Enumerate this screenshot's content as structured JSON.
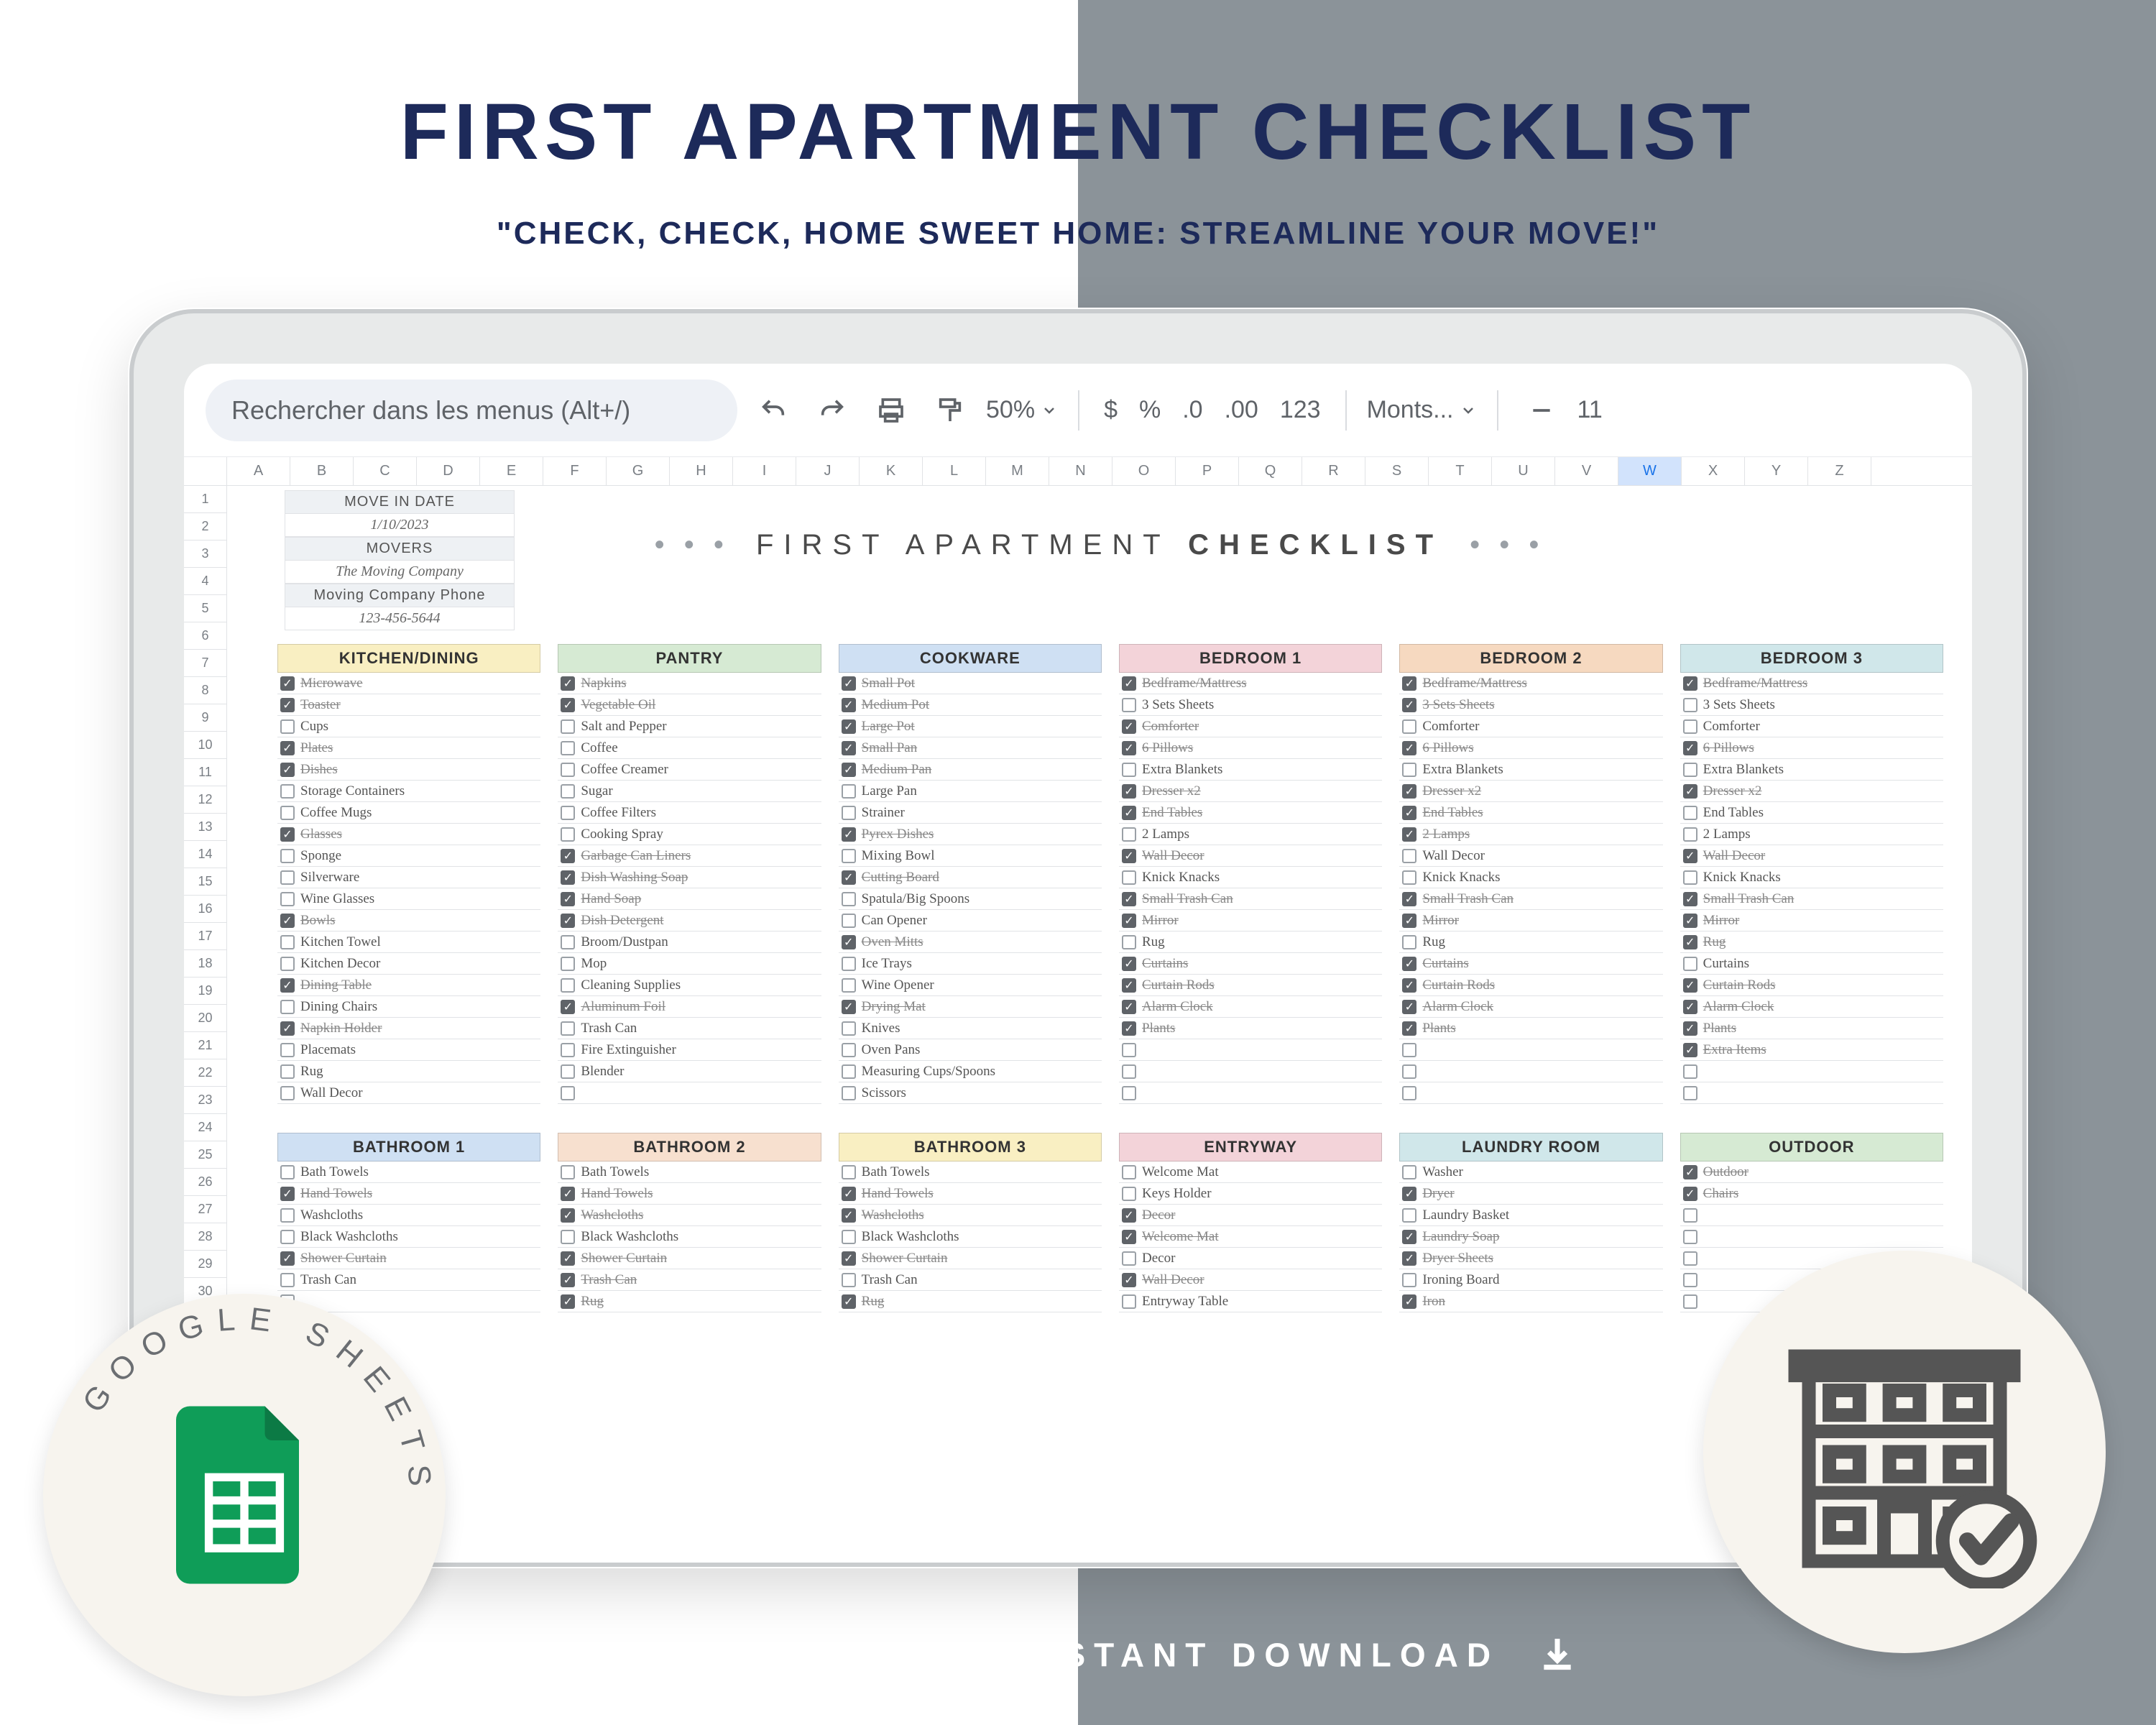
{
  "title": "FIRST APARTMENT CHECKLIST",
  "subtitle": "\"CHECK, CHECK, HOME SWEET HOME: STREAMLINE YOUR MOVE!\"",
  "footer": "GOOGLESHEETS | INSTANT DOWNLOAD",
  "toolbar": {
    "search_placeholder": "Rechercher dans les menus (Alt+/)",
    "zoom": "50%",
    "currency": "$",
    "percent": "%",
    "dec_minus": ".0",
    "dec_plus": ".00",
    "format_123": "123",
    "font": "Monts...",
    "font_size": "11"
  },
  "columns": [
    "A",
    "B",
    "C",
    "D",
    "E",
    "F",
    "G",
    "H",
    "I",
    "J",
    "K",
    "L",
    "M",
    "N",
    "O",
    "P",
    "Q",
    "R",
    "S",
    "T",
    "U",
    "V",
    "W",
    "X",
    "Y",
    "Z"
  ],
  "selected_column_index": 22,
  "row_count": 37,
  "info": {
    "move_in_label": "MOVE IN DATE",
    "move_in_value": "1/10/2023",
    "movers_label": "MOVERS",
    "movers_value": "The Moving Company",
    "phone_label": "Moving Company Phone",
    "phone_value": "123-456-5644"
  },
  "sheet_title_pre": "FIRST APARTMENT ",
  "sheet_title_bold": "CHECKLIST",
  "badge_text": "GOOGLE SHEETS",
  "category_colors": {
    "yellow": "#f9efc2",
    "green": "#d6ead3",
    "blue": "#cfe0f3",
    "pink": "#f3d3d9",
    "orange": "#f6d9c0",
    "lblue": "#d0e7ea",
    "peach": "#f7e0cf"
  },
  "categories_row1": [
    {
      "name": "KITCHEN/DINING",
      "color": "yellow",
      "items": [
        {
          "label": "Microwave",
          "done": true
        },
        {
          "label": "Toaster",
          "done": true
        },
        {
          "label": "Cups",
          "done": false
        },
        {
          "label": "Plates",
          "done": true
        },
        {
          "label": "Dishes",
          "done": true
        },
        {
          "label": "Storage Containers",
          "done": false
        },
        {
          "label": "Coffee Mugs",
          "done": false
        },
        {
          "label": "Glasses",
          "done": true
        },
        {
          "label": "Sponge",
          "done": false
        },
        {
          "label": "Silverware",
          "done": false
        },
        {
          "label": "Wine Glasses",
          "done": false
        },
        {
          "label": "Bowls",
          "done": true
        },
        {
          "label": "Kitchen Towel",
          "done": false
        },
        {
          "label": "Kitchen Decor",
          "done": false
        },
        {
          "label": "Dining Table",
          "done": true
        },
        {
          "label": "Dining Chairs",
          "done": false
        },
        {
          "label": "Napkin Holder",
          "done": true
        },
        {
          "label": "Placemats",
          "done": false
        },
        {
          "label": "Rug",
          "done": false
        },
        {
          "label": "Wall Decor",
          "done": false
        }
      ]
    },
    {
      "name": "PANTRY",
      "color": "green",
      "items": [
        {
          "label": "Napkins",
          "done": true
        },
        {
          "label": "Vegetable Oil",
          "done": true
        },
        {
          "label": "Salt and Pepper",
          "done": false
        },
        {
          "label": "Coffee",
          "done": false
        },
        {
          "label": "Coffee Creamer",
          "done": false
        },
        {
          "label": "Sugar",
          "done": false
        },
        {
          "label": "Coffee Filters",
          "done": false
        },
        {
          "label": "Cooking Spray",
          "done": false
        },
        {
          "label": "Garbage Can Liners",
          "done": true
        },
        {
          "label": "Dish Washing Soap",
          "done": true
        },
        {
          "label": "Hand Soap",
          "done": true
        },
        {
          "label": "Dish Detergent",
          "done": true
        },
        {
          "label": "Broom/Dustpan",
          "done": false
        },
        {
          "label": "Mop",
          "done": false
        },
        {
          "label": "Cleaning Supplies",
          "done": false
        },
        {
          "label": "Aluminum Foil",
          "done": true
        },
        {
          "label": "Trash Can",
          "done": false
        },
        {
          "label": "Fire Extinguisher",
          "done": false
        },
        {
          "label": "Blender",
          "done": false
        },
        {
          "label": "",
          "done": false
        }
      ]
    },
    {
      "name": "COOKWARE",
      "color": "blue",
      "items": [
        {
          "label": "Small Pot",
          "done": true
        },
        {
          "label": "Medium Pot",
          "done": true
        },
        {
          "label": "Large Pot",
          "done": true
        },
        {
          "label": "Small Pan",
          "done": true
        },
        {
          "label": "Medium Pan",
          "done": true
        },
        {
          "label": "Large Pan",
          "done": false
        },
        {
          "label": "Strainer",
          "done": false
        },
        {
          "label": "Pyrex Dishes",
          "done": true
        },
        {
          "label": "Mixing Bowl",
          "done": false
        },
        {
          "label": "Cutting Board",
          "done": true
        },
        {
          "label": "Spatula/Big Spoons",
          "done": false
        },
        {
          "label": "Can Opener",
          "done": false
        },
        {
          "label": "Oven Mitts",
          "done": true
        },
        {
          "label": "Ice Trays",
          "done": false
        },
        {
          "label": "Wine Opener",
          "done": false
        },
        {
          "label": "Drying Mat",
          "done": true
        },
        {
          "label": "Knives",
          "done": false
        },
        {
          "label": "Oven Pans",
          "done": false
        },
        {
          "label": "Measuring Cups/Spoons",
          "done": false
        },
        {
          "label": "Scissors",
          "done": false
        }
      ]
    },
    {
      "name": "BEDROOM 1",
      "color": "pink",
      "items": [
        {
          "label": "Bedframe/Mattress",
          "done": true
        },
        {
          "label": "3 Sets Sheets",
          "done": false
        },
        {
          "label": "Comforter",
          "done": true
        },
        {
          "label": "6 Pillows",
          "done": true
        },
        {
          "label": "Extra Blankets",
          "done": false
        },
        {
          "label": "Dresser x2",
          "done": true
        },
        {
          "label": "End Tables",
          "done": true
        },
        {
          "label": "2 Lamps",
          "done": false
        },
        {
          "label": "Wall Decor",
          "done": true
        },
        {
          "label": "Knick Knacks",
          "done": false
        },
        {
          "label": "Small Trash Can",
          "done": true
        },
        {
          "label": "Mirror",
          "done": true
        },
        {
          "label": "Rug",
          "done": false
        },
        {
          "label": "Curtains",
          "done": true
        },
        {
          "label": "Curtain Rods",
          "done": true
        },
        {
          "label": "Alarm Clock",
          "done": true
        },
        {
          "label": "Plants",
          "done": true
        },
        {
          "label": "",
          "done": false
        },
        {
          "label": "",
          "done": false
        },
        {
          "label": "",
          "done": false
        }
      ]
    },
    {
      "name": "BEDROOM 2",
      "color": "orange",
      "items": [
        {
          "label": "Bedframe/Mattress",
          "done": true
        },
        {
          "label": "3 Sets Sheets",
          "done": true
        },
        {
          "label": "Comforter",
          "done": false
        },
        {
          "label": "6 Pillows",
          "done": true
        },
        {
          "label": "Extra Blankets",
          "done": false
        },
        {
          "label": "Dresser x2",
          "done": true
        },
        {
          "label": "End Tables",
          "done": true
        },
        {
          "label": "2 Lamps",
          "done": true
        },
        {
          "label": "Wall Decor",
          "done": false
        },
        {
          "label": "Knick Knacks",
          "done": false
        },
        {
          "label": "Small Trash Can",
          "done": true
        },
        {
          "label": "Mirror",
          "done": true
        },
        {
          "label": "Rug",
          "done": false
        },
        {
          "label": "Curtains",
          "done": true
        },
        {
          "label": "Curtain Rods",
          "done": true
        },
        {
          "label": "Alarm Clock",
          "done": true
        },
        {
          "label": "Plants",
          "done": true
        },
        {
          "label": "",
          "done": false
        },
        {
          "label": "",
          "done": false
        },
        {
          "label": "",
          "done": false
        }
      ]
    },
    {
      "name": "BEDROOM 3",
      "color": "lblue",
      "items": [
        {
          "label": "Bedframe/Mattress",
          "done": true
        },
        {
          "label": "3 Sets Sheets",
          "done": false
        },
        {
          "label": "Comforter",
          "done": false
        },
        {
          "label": "6 Pillows",
          "done": true
        },
        {
          "label": "Extra Blankets",
          "done": false
        },
        {
          "label": "Dresser x2",
          "done": true
        },
        {
          "label": "End Tables",
          "done": false
        },
        {
          "label": "2 Lamps",
          "done": false
        },
        {
          "label": "Wall Decor",
          "done": true
        },
        {
          "label": "Knick Knacks",
          "done": false
        },
        {
          "label": "Small Trash Can",
          "done": true
        },
        {
          "label": "Mirror",
          "done": true
        },
        {
          "label": "Rug",
          "done": true
        },
        {
          "label": "Curtains",
          "done": false
        },
        {
          "label": "Curtain Rods",
          "done": true
        },
        {
          "label": "Alarm Clock",
          "done": true
        },
        {
          "label": "Plants",
          "done": true
        },
        {
          "label": "Extra Items",
          "done": true
        },
        {
          "label": "",
          "done": false
        },
        {
          "label": "",
          "done": false
        }
      ]
    }
  ],
  "categories_row2": [
    {
      "name": "BATHROOM 1",
      "color": "blue",
      "items": [
        {
          "label": "Bath Towels",
          "done": false
        },
        {
          "label": "Hand Towels",
          "done": true
        },
        {
          "label": "Washcloths",
          "done": false
        },
        {
          "label": "Black Washcloths",
          "done": false
        },
        {
          "label": "Shower Curtain",
          "done": true
        },
        {
          "label": "Trash Can",
          "done": false
        },
        {
          "label": "",
          "done": false
        }
      ]
    },
    {
      "name": "BATHROOM 2",
      "color": "peach",
      "items": [
        {
          "label": "Bath Towels",
          "done": false
        },
        {
          "label": "Hand Towels",
          "done": true
        },
        {
          "label": "Washcloths",
          "done": true
        },
        {
          "label": "Black Washcloths",
          "done": false
        },
        {
          "label": "Shower Curtain",
          "done": true
        },
        {
          "label": "Trash Can",
          "done": true
        },
        {
          "label": "Rug",
          "done": true
        }
      ]
    },
    {
      "name": "BATHROOM 3",
      "color": "yellow",
      "items": [
        {
          "label": "Bath Towels",
          "done": false
        },
        {
          "label": "Hand Towels",
          "done": true
        },
        {
          "label": "Washcloths",
          "done": true
        },
        {
          "label": "Black Washcloths",
          "done": false
        },
        {
          "label": "Shower Curtain",
          "done": true
        },
        {
          "label": "Trash Can",
          "done": false
        },
        {
          "label": "Rug",
          "done": true
        }
      ]
    },
    {
      "name": "ENTRYWAY",
      "color": "pink",
      "items": [
        {
          "label": "Welcome Mat",
          "done": false
        },
        {
          "label": "Keys Holder",
          "done": false
        },
        {
          "label": "Decor",
          "done": true
        },
        {
          "label": "Welcome Mat",
          "done": true
        },
        {
          "label": "Decor",
          "done": false
        },
        {
          "label": "Wall Decor",
          "done": true
        },
        {
          "label": "Entryway Table",
          "done": false
        }
      ]
    },
    {
      "name": "LAUNDRY ROOM",
      "color": "lblue",
      "items": [
        {
          "label": "Washer",
          "done": false
        },
        {
          "label": "Dryer",
          "done": true
        },
        {
          "label": "Laundry Basket",
          "done": false
        },
        {
          "label": "Laundry Soap",
          "done": true
        },
        {
          "label": "Dryer Sheets",
          "done": true
        },
        {
          "label": "Ironing Board",
          "done": false
        },
        {
          "label": "Iron",
          "done": true
        }
      ]
    },
    {
      "name": "OUTDOOR",
      "color": "green",
      "items": [
        {
          "label": "Outdoor",
          "done": true
        },
        {
          "label": "Chairs",
          "done": true
        },
        {
          "label": "",
          "done": false
        },
        {
          "label": "",
          "done": false
        },
        {
          "label": "",
          "done": false
        },
        {
          "label": "",
          "done": false
        },
        {
          "label": "",
          "done": false
        }
      ]
    }
  ]
}
